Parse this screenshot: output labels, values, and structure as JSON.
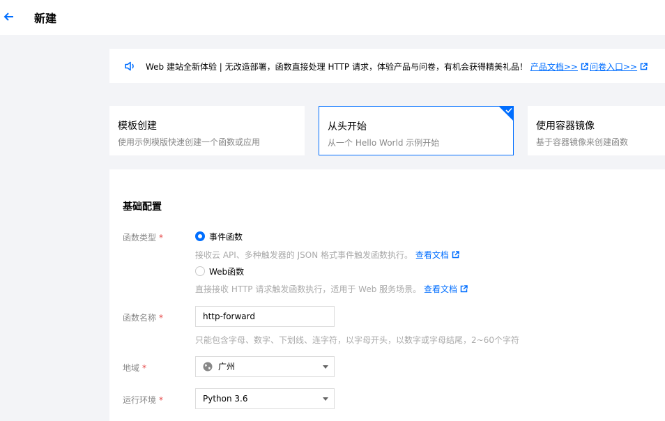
{
  "header": {
    "title": "新建"
  },
  "notice": {
    "text": "Web 建站全新体验 | 无改造部署，函数直接处理 HTTP 请求，体验产品与问卷，有机会获得精美礼品！",
    "link1": "产品文档>>",
    "link2": "问卷入口>>"
  },
  "create_modes": [
    {
      "title": "模板创建",
      "desc": "使用示例模版快速创建一个函数或应用"
    },
    {
      "title": "从头开始",
      "desc": "从一个 Hello World 示例开始"
    },
    {
      "title": "使用容器镜像",
      "desc": "基于容器镜像来创建函数"
    }
  ],
  "form": {
    "section_title": "基础配置",
    "function_type": {
      "label": "函数类型",
      "options": [
        {
          "label": "事件函数",
          "help": "接收云 API、多种触发器的 JSON 格式事件触发函数执行。",
          "link": "查看文档"
        },
        {
          "label": "Web函数",
          "help": "直接接收 HTTP 请求触发函数执行，适用于 Web 服务场景。",
          "link": "查看文档"
        }
      ]
    },
    "function_name": {
      "label": "函数名称",
      "value": "http-forward",
      "help": "只能包含字母、数字、下划线、连字符，以字母开头，以数字或字母结尾，2~60个字符"
    },
    "region": {
      "label": "地域",
      "value": "广州"
    },
    "runtime": {
      "label": "运行环境",
      "value": "Python 3.6"
    }
  }
}
